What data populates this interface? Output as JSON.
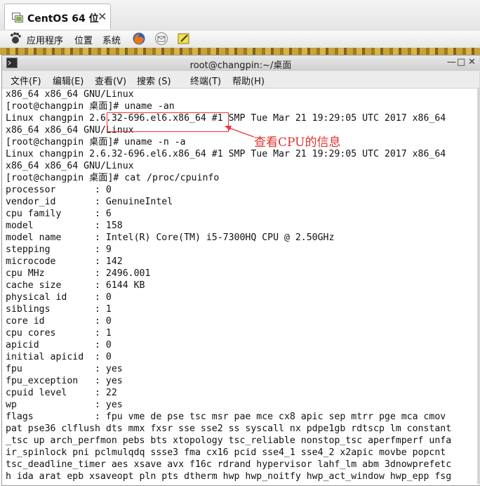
{
  "vm_tab": {
    "title": "CentOS 64 位",
    "close": "✕"
  },
  "panel": {
    "applications": "应用程序",
    "places": "位置",
    "system": "系统"
  },
  "window": {
    "title": "root@changpin:~/桌面",
    "minimize": "—",
    "maximize": "□",
    "close": "✕"
  },
  "menubar": [
    "文件(F)",
    "编辑(E)",
    "查看(V)",
    "搜索 (S)",
    "终端(T)",
    "帮助(H)"
  ],
  "terminal_lines": [
    "x86_64 x86_64 GNU/Linux",
    "[root@changpin 桌面]# uname -an",
    "Linux changpin 2.6.32-696.el6.x86_64 #1 SMP Tue Mar 21 19:29:05 UTC 2017 x86_64",
    "x86_64 x86_64 GNU/Linux",
    "[root@changpin 桌面]# uname -n -a",
    "Linux changpin 2.6.32-696.el6.x86_64 #1 SMP Tue Mar 21 19:29:05 UTC 2017 x86_64",
    "x86_64 x86_64 GNU/Linux",
    "[root@changpin 桌面]# cat /proc/cpuinfo",
    "processor       : 0",
    "vendor_id       : GenuineIntel",
    "cpu family      : 6",
    "model           : 158",
    "model name      : Intel(R) Core(TM) i5-7300HQ CPU @ 2.50GHz",
    "stepping        : 9",
    "microcode       : 142",
    "cpu MHz         : 2496.001",
    "cache size      : 6144 KB",
    "physical id     : 0",
    "siblings        : 1",
    "core id         : 0",
    "cpu cores       : 1",
    "apicid          : 0",
    "initial apicid  : 0",
    "fpu             : yes",
    "fpu_exception   : yes",
    "cpuid level     : 22",
    "wp              : yes",
    "flags           : fpu vme de pse tsc msr pae mce cx8 apic sep mtrr pge mca cmov",
    "pat pse36 clflush dts mmx fxsr sse sse2 ss syscall nx pdpe1gb rdtscp lm constant",
    "_tsc up arch_perfmon pebs bts xtopology tsc_reliable nonstop_tsc aperfmperf unfa",
    "ir_spinlock pni pclmulqdq ssse3 fma cx16 pcid sse4_1 sse4_2 x2apic movbe popcnt",
    "tsc_deadline_timer aes xsave avx f16c rdrand hypervisor lahf_lm abm 3dnowprefetc",
    "h ida arat epb xsaveopt pln pts dtherm hwp hwp_noitfy hwp_act_window hwp_epp fsg"
  ],
  "annotation": "查看CPU的信息",
  "colors": {
    "annotation": "#e0312b",
    "terminal_text": "#111111"
  },
  "icons": [
    "vm-icon",
    "gnome-foot-icon",
    "firefox-icon",
    "mail-icon",
    "notes-icon",
    "terminal-icon"
  ]
}
